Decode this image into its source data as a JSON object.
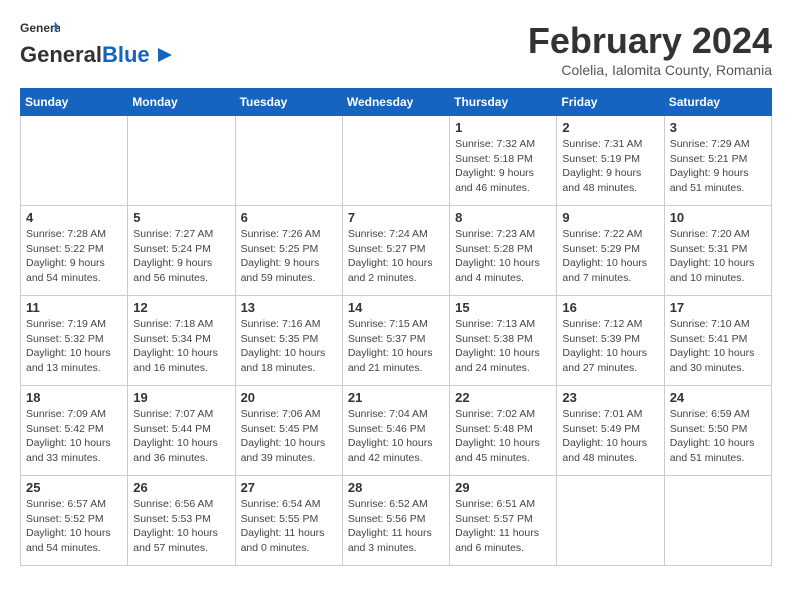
{
  "logo": {
    "general": "General",
    "blue": "Blue"
  },
  "header": {
    "month_year": "February 2024",
    "location": "Colelia, Ialomita County, Romania"
  },
  "days_of_week": [
    "Sunday",
    "Monday",
    "Tuesday",
    "Wednesday",
    "Thursday",
    "Friday",
    "Saturday"
  ],
  "weeks": [
    [
      {
        "date": "",
        "info": ""
      },
      {
        "date": "",
        "info": ""
      },
      {
        "date": "",
        "info": ""
      },
      {
        "date": "",
        "info": ""
      },
      {
        "date": "1",
        "info": "Sunrise: 7:32 AM\nSunset: 5:18 PM\nDaylight: 9 hours\nand 46 minutes."
      },
      {
        "date": "2",
        "info": "Sunrise: 7:31 AM\nSunset: 5:19 PM\nDaylight: 9 hours\nand 48 minutes."
      },
      {
        "date": "3",
        "info": "Sunrise: 7:29 AM\nSunset: 5:21 PM\nDaylight: 9 hours\nand 51 minutes."
      }
    ],
    [
      {
        "date": "4",
        "info": "Sunrise: 7:28 AM\nSunset: 5:22 PM\nDaylight: 9 hours\nand 54 minutes."
      },
      {
        "date": "5",
        "info": "Sunrise: 7:27 AM\nSunset: 5:24 PM\nDaylight: 9 hours\nand 56 minutes."
      },
      {
        "date": "6",
        "info": "Sunrise: 7:26 AM\nSunset: 5:25 PM\nDaylight: 9 hours\nand 59 minutes."
      },
      {
        "date": "7",
        "info": "Sunrise: 7:24 AM\nSunset: 5:27 PM\nDaylight: 10 hours\nand 2 minutes."
      },
      {
        "date": "8",
        "info": "Sunrise: 7:23 AM\nSunset: 5:28 PM\nDaylight: 10 hours\nand 4 minutes."
      },
      {
        "date": "9",
        "info": "Sunrise: 7:22 AM\nSunset: 5:29 PM\nDaylight: 10 hours\nand 7 minutes."
      },
      {
        "date": "10",
        "info": "Sunrise: 7:20 AM\nSunset: 5:31 PM\nDaylight: 10 hours\nand 10 minutes."
      }
    ],
    [
      {
        "date": "11",
        "info": "Sunrise: 7:19 AM\nSunset: 5:32 PM\nDaylight: 10 hours\nand 13 minutes."
      },
      {
        "date": "12",
        "info": "Sunrise: 7:18 AM\nSunset: 5:34 PM\nDaylight: 10 hours\nand 16 minutes."
      },
      {
        "date": "13",
        "info": "Sunrise: 7:16 AM\nSunset: 5:35 PM\nDaylight: 10 hours\nand 18 minutes."
      },
      {
        "date": "14",
        "info": "Sunrise: 7:15 AM\nSunset: 5:37 PM\nDaylight: 10 hours\nand 21 minutes."
      },
      {
        "date": "15",
        "info": "Sunrise: 7:13 AM\nSunset: 5:38 PM\nDaylight: 10 hours\nand 24 minutes."
      },
      {
        "date": "16",
        "info": "Sunrise: 7:12 AM\nSunset: 5:39 PM\nDaylight: 10 hours\nand 27 minutes."
      },
      {
        "date": "17",
        "info": "Sunrise: 7:10 AM\nSunset: 5:41 PM\nDaylight: 10 hours\nand 30 minutes."
      }
    ],
    [
      {
        "date": "18",
        "info": "Sunrise: 7:09 AM\nSunset: 5:42 PM\nDaylight: 10 hours\nand 33 minutes."
      },
      {
        "date": "19",
        "info": "Sunrise: 7:07 AM\nSunset: 5:44 PM\nDaylight: 10 hours\nand 36 minutes."
      },
      {
        "date": "20",
        "info": "Sunrise: 7:06 AM\nSunset: 5:45 PM\nDaylight: 10 hours\nand 39 minutes."
      },
      {
        "date": "21",
        "info": "Sunrise: 7:04 AM\nSunset: 5:46 PM\nDaylight: 10 hours\nand 42 minutes."
      },
      {
        "date": "22",
        "info": "Sunrise: 7:02 AM\nSunset: 5:48 PM\nDaylight: 10 hours\nand 45 minutes."
      },
      {
        "date": "23",
        "info": "Sunrise: 7:01 AM\nSunset: 5:49 PM\nDaylight: 10 hours\nand 48 minutes."
      },
      {
        "date": "24",
        "info": "Sunrise: 6:59 AM\nSunset: 5:50 PM\nDaylight: 10 hours\nand 51 minutes."
      }
    ],
    [
      {
        "date": "25",
        "info": "Sunrise: 6:57 AM\nSunset: 5:52 PM\nDaylight: 10 hours\nand 54 minutes."
      },
      {
        "date": "26",
        "info": "Sunrise: 6:56 AM\nSunset: 5:53 PM\nDaylight: 10 hours\nand 57 minutes."
      },
      {
        "date": "27",
        "info": "Sunrise: 6:54 AM\nSunset: 5:55 PM\nDaylight: 11 hours\nand 0 minutes."
      },
      {
        "date": "28",
        "info": "Sunrise: 6:52 AM\nSunset: 5:56 PM\nDaylight: 11 hours\nand 3 minutes."
      },
      {
        "date": "29",
        "info": "Sunrise: 6:51 AM\nSunset: 5:57 PM\nDaylight: 11 hours\nand 6 minutes."
      },
      {
        "date": "",
        "info": ""
      },
      {
        "date": "",
        "info": ""
      }
    ]
  ]
}
